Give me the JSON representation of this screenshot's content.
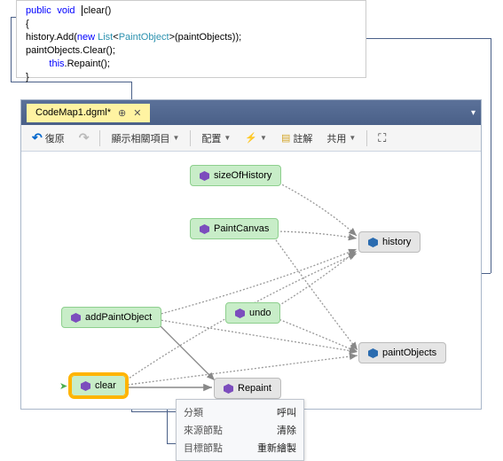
{
  "code": {
    "l1_public": "public",
    "l1_void": "void",
    "l1_method": "clear()",
    "l2": "{",
    "l3a": "    history.Add(",
    "l3_new": "new",
    "l3b": " ",
    "l3_list": "List",
    "l3c": "<",
    "l3_type": "PaintObject",
    "l3d": ">(paintObjects));",
    "l4": "    paintObjects.Clear();",
    "l5_this": "this",
    "l5b": ".Repaint();",
    "l6": "}"
  },
  "tab": {
    "title": "CodeMap1.dgml*",
    "pin": "⊕",
    "close": "✕",
    "winmenu": "▾"
  },
  "toolbar": {
    "undo": "復原",
    "related": "顯示相關項目",
    "layout": "配置",
    "annotate": "註解",
    "share": "共用"
  },
  "nodes": {
    "sizeOfHistory": "sizeOfHistory",
    "PaintCanvas": "PaintCanvas",
    "addPaintObject": "addPaintObject",
    "undo": "undo",
    "clear": "clear",
    "history": "history",
    "paintObjects": "paintObjects",
    "Repaint": "Repaint"
  },
  "tooltip": {
    "k1": "分類",
    "v1": "呼叫",
    "k2": "來源節點",
    "v2": "清除",
    "k3": "目標節點",
    "v3": "重新繪製"
  }
}
